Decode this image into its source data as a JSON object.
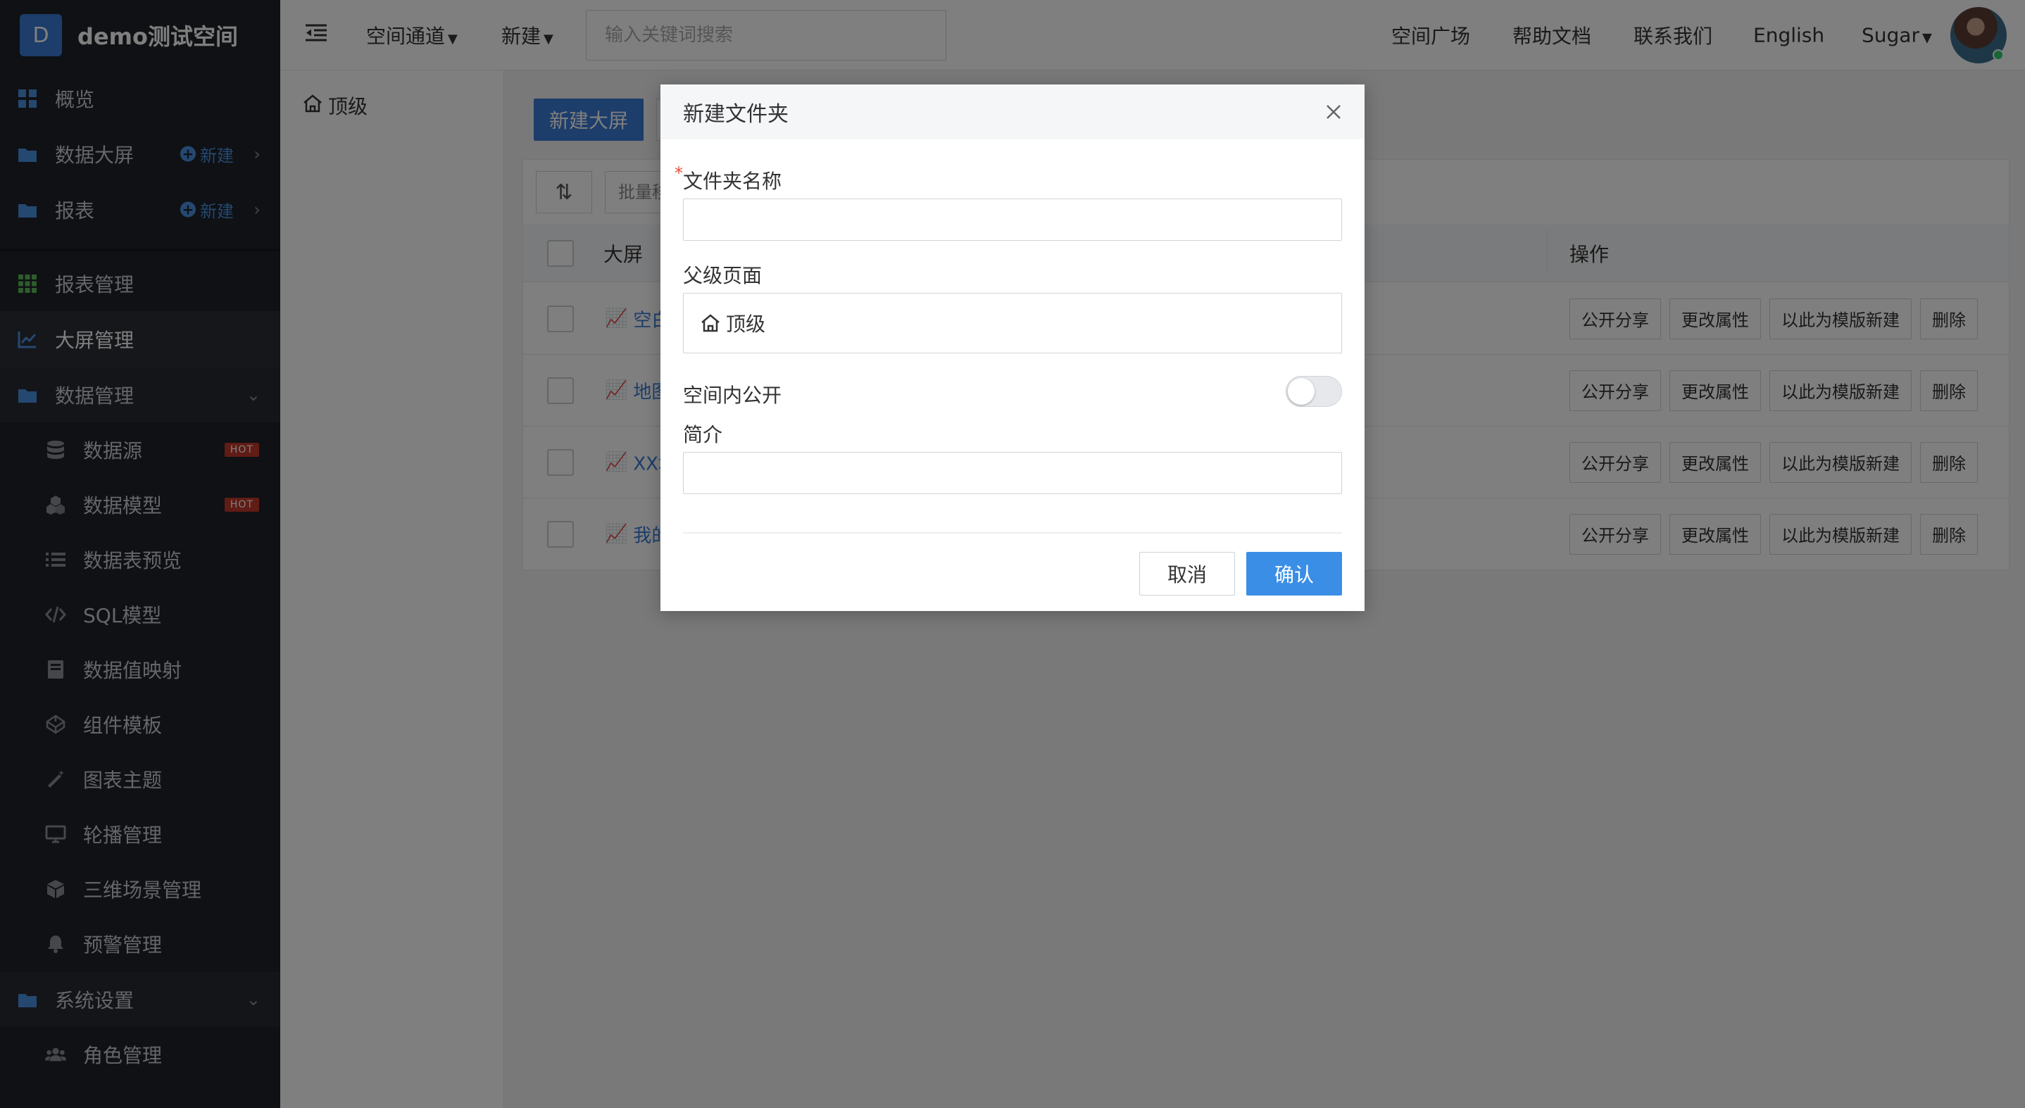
{
  "brand": {
    "badge": "D",
    "name": "demo测试空间"
  },
  "sidebar": {
    "top_items": [
      {
        "label": "概览",
        "icon": "dashboard-grid-icon"
      },
      {
        "label": "数据大屏",
        "icon": "folder-icon",
        "add_label": "新建"
      },
      {
        "label": "报表",
        "icon": "folder-icon",
        "add_label": "新建"
      }
    ],
    "items": [
      {
        "label": "报表管理",
        "icon": "apps-grid-icon"
      },
      {
        "label": "大屏管理",
        "icon": "line-chart-icon",
        "active": true
      },
      {
        "label": "数据管理",
        "icon": "folder-icon",
        "expanded": true
      },
      {
        "label": "数据源",
        "icon": "database-icon",
        "badge": "HOT"
      },
      {
        "label": "数据模型",
        "icon": "cubes-icon",
        "badge": "HOT"
      },
      {
        "label": "数据表预览",
        "icon": "list-icon"
      },
      {
        "label": "SQL模型",
        "icon": "code-icon"
      },
      {
        "label": "数据值映射",
        "icon": "book-icon"
      },
      {
        "label": "组件模板",
        "icon": "codepen-icon"
      },
      {
        "label": "图表主题",
        "icon": "magic-wand-icon"
      },
      {
        "label": "轮播管理",
        "icon": "monitor-icon"
      },
      {
        "label": "三维场景管理",
        "icon": "cube-icon"
      },
      {
        "label": "预警管理",
        "icon": "bell-icon"
      },
      {
        "label": "系统设置",
        "icon": "folder-icon",
        "expanded": true
      },
      {
        "label": "角色管理",
        "icon": "users-icon"
      }
    ]
  },
  "topbar": {
    "channel": "空间通道",
    "new": "新建",
    "search_placeholder": "输入关键词搜索",
    "links": [
      "空间广场",
      "帮助文档",
      "联系我们",
      "English"
    ],
    "user": "Sugar"
  },
  "tree": {
    "root": "顶级"
  },
  "content": {
    "new_screen_button": "新建大屏",
    "batch_button": "批量移",
    "table": {
      "col_name": "大屏",
      "col_actions": "操作",
      "rows": [
        "空白",
        "地图",
        "XX城",
        "我的"
      ],
      "actions": [
        "公开分享",
        "更改属性",
        "以此为模版新建",
        "删除"
      ]
    }
  },
  "modal": {
    "title": "新建文件夹",
    "folder_name_label": "文件夹名称",
    "required_mark": "*",
    "folder_name_value": "",
    "parent_label": "父级页面",
    "parent_value": "顶级",
    "public_label": "空间内公开",
    "public_enabled": false,
    "intro_label": "简介",
    "intro_value": "",
    "cancel": "取消",
    "confirm": "确认"
  },
  "colors": {
    "primary": "#3a7bd5",
    "sidebar_bg": "#1f2329",
    "hot": "#c0392b"
  }
}
